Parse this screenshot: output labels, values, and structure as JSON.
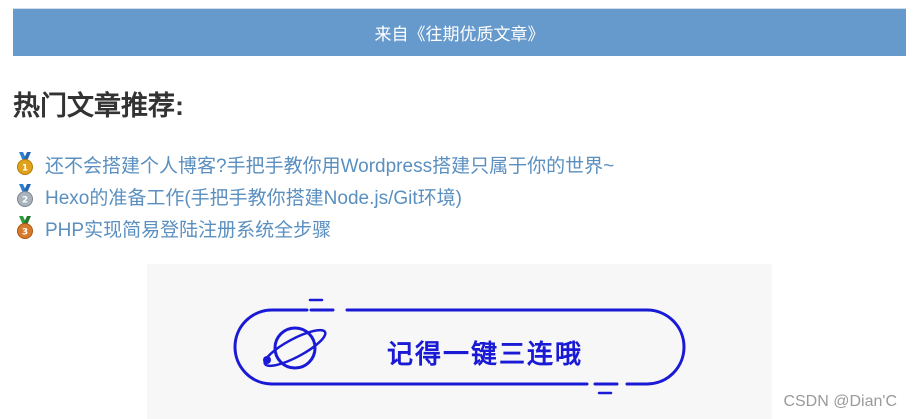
{
  "banner": {
    "text": "来自《往期优质文章》"
  },
  "section": {
    "heading": "热门文章推荐:"
  },
  "articles": [
    {
      "title": "还不会搭建个人博客?手把手教你用Wordpress搭建只属于你的世界~",
      "medal": "gold-medal-icon",
      "ribbon_color": "#2e7fd1",
      "medal_color": "#e0a21a"
    },
    {
      "title": "Hexo的准备工作(手把手教你搭建Node.js/Git环境)",
      "medal": "silver-medal-icon",
      "ribbon_color": "#2e7fd1",
      "medal_color": "#a9b3bd"
    },
    {
      "title": "PHP实现简易登陆注册系统全步骤",
      "medal": "bronze-medal-icon",
      "ribbon_color": "#2e9d3a",
      "medal_color": "#d97a2b"
    }
  ],
  "cta": {
    "text": "记得一键三连哦",
    "icon": "planet-icon",
    "color": "#1a1ad6"
  },
  "watermark": {
    "text": "CSDN @Dian'C"
  }
}
